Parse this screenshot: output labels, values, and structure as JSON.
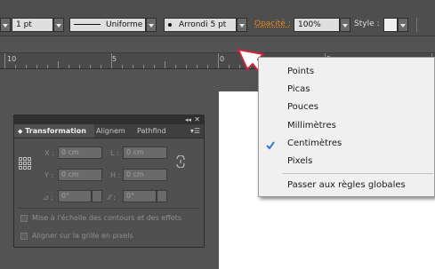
{
  "toolbar": {
    "stroke_weight": "1 pt",
    "stroke_profile": "Uniforme",
    "brush": "Arrondi 5 pt",
    "opacity_label": "Opacité :",
    "opacity_value": "100%",
    "style_label": "Style :"
  },
  "ruler": {
    "labels": [
      "10",
      "5",
      "0",
      "5"
    ]
  },
  "panel": {
    "tab_transform": "Transformation",
    "tab_align": "Alignem",
    "tab_pathfinder": "Pathfind",
    "x_label": "X :",
    "x_value": "0 cm",
    "y_label": "Y :",
    "y_value": "0 cm",
    "w_label": "L :",
    "w_value": "0 cm",
    "h_label": "H :",
    "h_value": "0 cm",
    "rotate_value": "0°",
    "shear_value": "0°",
    "scale_strokes_label": "Mise à l'échelle des contours et des effets",
    "align_grid_label": "Aligner sur la grille en pixels"
  },
  "menu": {
    "items": [
      "Points",
      "Picas",
      "Pouces",
      "Millimètres",
      "Centimètres",
      "Pixels"
    ],
    "checked_index": 4,
    "global_item": "Passer aux règles globales",
    "check_color": "#2f7fd6"
  },
  "colors": {
    "opacity_label": "#e88a1a",
    "annotation_arrow": "#d0253b"
  }
}
